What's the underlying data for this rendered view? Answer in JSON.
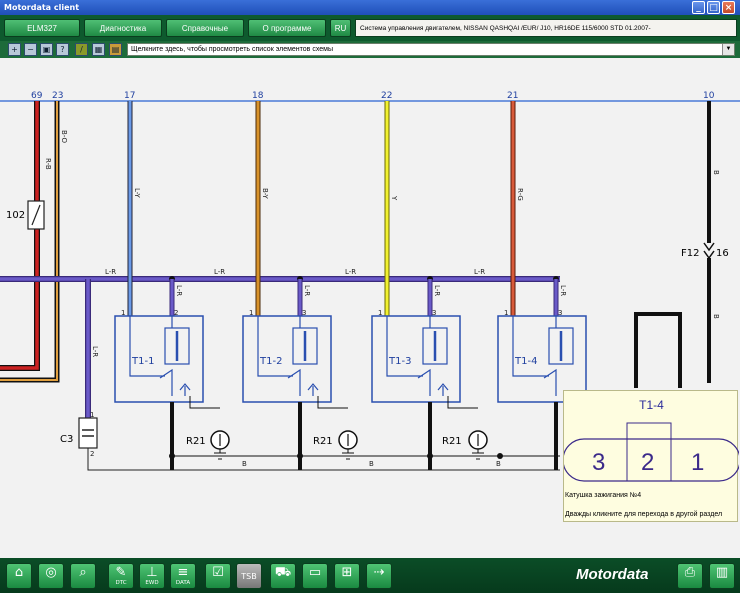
{
  "window": {
    "title": "Motordata client"
  },
  "menu": {
    "buttons": [
      "ELM327",
      "Диагностика",
      "Справочные данные",
      "О программе",
      "RU"
    ],
    "system_info": "Система управления двигателем, NISSAN  QASHQAI /EUR/  J10,  HR16DE 115/6000  STD  01.2007-"
  },
  "toolbar": {
    "hint_text": "Щелкните здесь, чтобы просмотреть список элементов схемы",
    "tools": [
      "zoom-in-icon",
      "zoom-out-icon",
      "zoom-fit-icon",
      "help-icon",
      "pen-icon",
      "grid-icon",
      "palette-icon"
    ]
  },
  "diagram": {
    "pins": [
      "69",
      "23",
      "17",
      "18",
      "22",
      "21",
      "10"
    ],
    "wire_labels": [
      "R-B",
      "B-O",
      "L-Y",
      "B-Y",
      "Y",
      "R-G",
      "B",
      "B",
      "L-R",
      "L-R",
      "L-R",
      "L-R",
      "L-R",
      "L-R",
      "L-R",
      "L-R",
      "L-R",
      "B",
      "B",
      "B"
    ],
    "components": {
      "coils": [
        "T1-1",
        "T1-2",
        "T1-3",
        "T1-4"
      ],
      "resistors": [
        "R21",
        "R21",
        "R21"
      ],
      "fuse": "102",
      "capacitor": "C3",
      "fuse_link": "F12",
      "fuse_link_pin": "16",
      "pin_numbers": [
        "1",
        "2",
        "1",
        "3",
        "1",
        "3",
        "1",
        "3",
        "1",
        "3",
        "1",
        "2"
      ]
    },
    "colors": {
      "bus": "#4a7ad8",
      "purple": "#6a4aa8",
      "red": "#cc2222",
      "blue_wire": "#4a8ad8",
      "orange": "#d88a22",
      "yellow": "#eeee22",
      "rg": "#cc5533",
      "component": "#2a4fb0"
    }
  },
  "popup": {
    "title": "T1-4",
    "pins": [
      "3",
      "2",
      "1"
    ],
    "description": "Катушка зажигания №4",
    "hint": "Дважды кликните для перехода в другой раздел"
  },
  "bottombar": {
    "icons": [
      {
        "name": "home-icon",
        "label": ""
      },
      {
        "name": "globe-icon",
        "label": ""
      },
      {
        "name": "search-icon",
        "label": ""
      },
      {
        "name": "dtc-icon",
        "label": "DTC"
      },
      {
        "name": "ewd-icon",
        "label": "EWD"
      },
      {
        "name": "data-icon",
        "label": "DATA"
      },
      {
        "name": "checklist-icon",
        "label": ""
      },
      {
        "name": "gauge-icon",
        "label": ""
      },
      {
        "name": "tsb-icon",
        "label": "TSB"
      },
      {
        "name": "car-icon",
        "label": ""
      },
      {
        "name": "junction-icon",
        "label": ""
      },
      {
        "name": "connector-icon",
        "label": ""
      },
      {
        "name": "http-icon",
        "label": ""
      }
    ],
    "brand": "Motordata"
  }
}
